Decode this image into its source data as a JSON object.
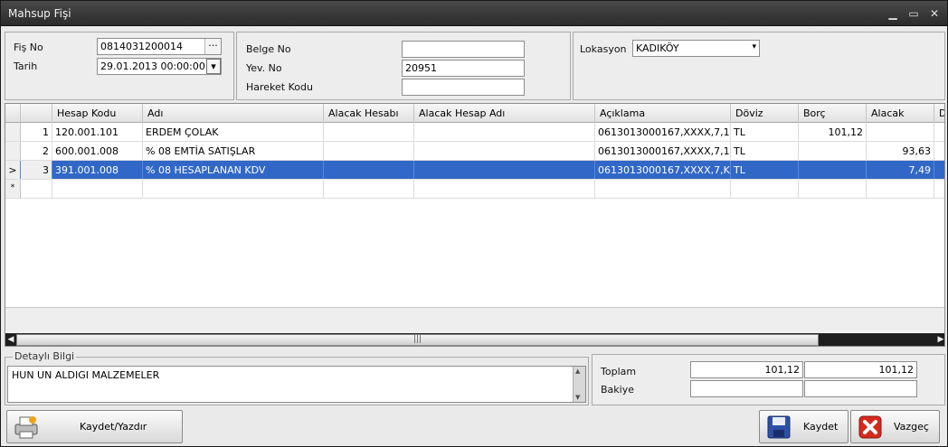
{
  "window": {
    "title": "Mahsup Fişi"
  },
  "header": {
    "fis_no_label": "Fiş No",
    "fis_no_value": "0814031200014",
    "fis_no_button": "···",
    "tarih_label": "Tarih",
    "tarih_value": "29.01.2013 00:00:00",
    "belge_no_label": "Belge No",
    "belge_no_value": "",
    "yev_no_label": "Yev. No",
    "yev_no_value": "20951",
    "hareket_kodu_label": "Hareket Kodu",
    "hareket_kodu_value": "",
    "lokasyon_label": "Lokasyon",
    "lokasyon_value": "KADIKÖY"
  },
  "grid": {
    "columns": [
      "Hesap Kodu",
      "Adı",
      "Alacak Hesabı",
      "Alacak Hesap Adı",
      "Açıklama",
      "Döviz",
      "Borç",
      "Alacak",
      "D"
    ],
    "rows": [
      {
        "no": "1",
        "hesap_kodu": "120.001.101",
        "adi": "ERDEM ÇOLAK",
        "alacak_hesabi": "",
        "alacak_hesap_adi": "",
        "aciklama": "0613013000167,XXXX,7,10...",
        "doviz": "TL",
        "borc": "101,12",
        "alacak": ""
      },
      {
        "no": "2",
        "hesap_kodu": "600.001.008",
        "adi": "% 08 EMTİA SATIŞLAR",
        "alacak_hesabi": "",
        "alacak_hesap_adi": "",
        "aciklama": "0613013000167,XXXX,7,10...",
        "doviz": "TL",
        "borc": "",
        "alacak": "93,63"
      },
      {
        "no": "3",
        "hesap_kodu": "391.001.008",
        "adi": "% 08 HESAPLANAN KDV",
        "alacak_hesabi": "",
        "alacak_hesap_adi": "",
        "aciklama": "0613013000167,XXXX,7,K...",
        "doviz": "TL",
        "borc": "",
        "alacak": "7,49"
      }
    ],
    "current_row_marker": ">",
    "new_row_marker": "*",
    "scroll_grip": "|||"
  },
  "detail": {
    "label": "Detaylı Bilgi",
    "text": "HUN UN ALDIGI MALZEMELER"
  },
  "totals": {
    "toplam_label": "Toplam",
    "toplam_borc": "101,12",
    "toplam_alacak": "101,12",
    "bakiye_label": "Bakiye",
    "bakiye_borc": "",
    "bakiye_alacak": ""
  },
  "buttons": {
    "kaydet_yazdir": "Kaydet/Yazdır",
    "kaydet": "Kaydet",
    "vazgec": "Vazgeç"
  }
}
